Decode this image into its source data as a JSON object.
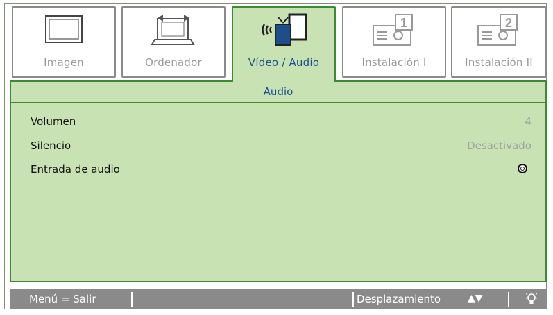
{
  "tabs": [
    {
      "label": "Imagen",
      "icon": "monitor-icon",
      "active": false
    },
    {
      "label": "Ordenador",
      "icon": "laptop-icon",
      "active": false
    },
    {
      "label": "Vídeo / Audio",
      "icon": "video-audio-icon",
      "active": true
    },
    {
      "label": "Instalación I",
      "icon": "projector-1-icon",
      "active": false
    },
    {
      "label": "Instalación II",
      "icon": "projector-2-icon",
      "active": false
    }
  ],
  "panel": {
    "title": "Audio",
    "rows": [
      {
        "label": "Volumen",
        "value": "4"
      },
      {
        "label": "Silencio",
        "value": "Desactivado"
      },
      {
        "label": "Entrada de audio",
        "value": ""
      }
    ]
  },
  "footer": {
    "exit": "Menú = Salir",
    "navigate": "Desplazamiento",
    "arrows": "▲▼"
  },
  "colors": {
    "accent_green": "#3d8a34",
    "panel_bg": "#c9e2b4",
    "active_text": "#1a4f8f",
    "footer_bg": "#8a8a8a"
  }
}
